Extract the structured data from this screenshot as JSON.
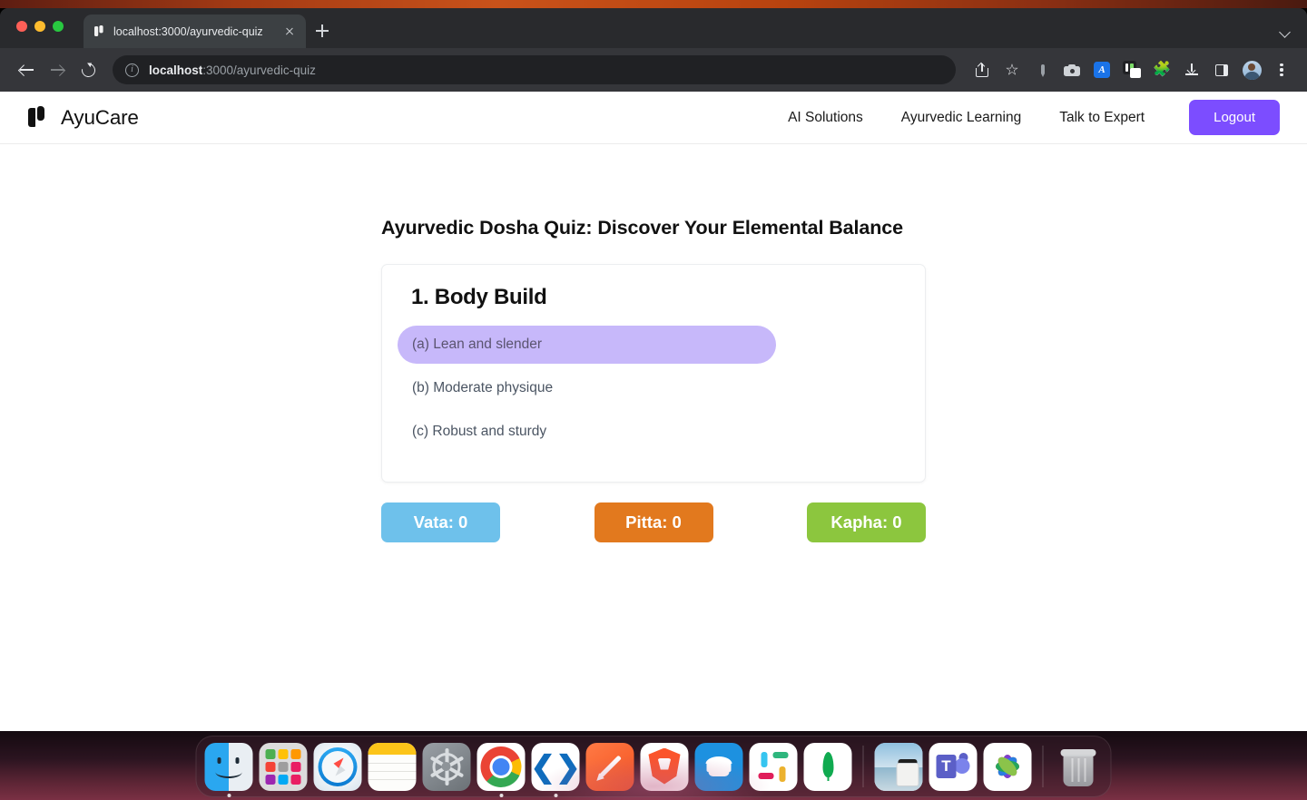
{
  "browser": {
    "tab": {
      "title": "localhost:3000/ayurvedic-quiz",
      "favicon": "ayucare-logo-icon",
      "close": "close-icon"
    },
    "new_tab": "+",
    "omnibox": {
      "host": "localhost",
      "path": ":3000/ayurvedic-quiz",
      "info_icon": "info-circle-icon"
    },
    "toolbar_icons": [
      "share-icon",
      "bookmark-star-icon",
      "pen-icon",
      "camera-icon",
      "grammar-extension-icon",
      "copy-extension-icon",
      "extensions-puzzle-icon",
      "download-icon",
      "sidebar-icon",
      "profile-avatar",
      "kebab-menu-icon"
    ]
  },
  "site": {
    "brand": "AyuCare",
    "nav": [
      {
        "label": "AI Solutions"
      },
      {
        "label": "Ayurvedic Learning"
      },
      {
        "label": "Talk to Expert"
      }
    ],
    "logout_label": "Logout",
    "accent_color": "#7c4dff"
  },
  "quiz": {
    "title": "Ayurvedic Dosha Quiz: Discover Your Elemental Balance",
    "question_number": "1.",
    "question": "1. Body Build",
    "options": [
      {
        "label": "(a) Lean and slender",
        "selected": true
      },
      {
        "label": "(b) Moderate physique",
        "selected": false
      },
      {
        "label": "(c) Robust and sturdy",
        "selected": false
      }
    ],
    "selected_color": "#c7b8fa",
    "scores": [
      {
        "label": "Vata: 0",
        "name": "Vata",
        "value": 0,
        "color": "#6ec1eb"
      },
      {
        "label": "Pitta: 0",
        "name": "Pitta",
        "value": 0,
        "color": "#e2791e"
      },
      {
        "label": "Kapha: 0",
        "name": "Kapha",
        "value": 0,
        "color": "#8cc63e"
      }
    ]
  },
  "dock": {
    "items": [
      {
        "name": "finder"
      },
      {
        "name": "launchpad"
      },
      {
        "name": "safari"
      },
      {
        "name": "notes"
      },
      {
        "name": "system-settings"
      },
      {
        "name": "google-chrome"
      },
      {
        "name": "visual-studio-code"
      },
      {
        "name": "pen-app"
      },
      {
        "name": "brave-browser"
      },
      {
        "name": "docker"
      },
      {
        "name": "slack"
      },
      {
        "name": "mongodb-compass"
      },
      {
        "name": "preview"
      },
      {
        "name": "microsoft-teams"
      },
      {
        "name": "photos"
      },
      {
        "name": "trash"
      }
    ]
  }
}
